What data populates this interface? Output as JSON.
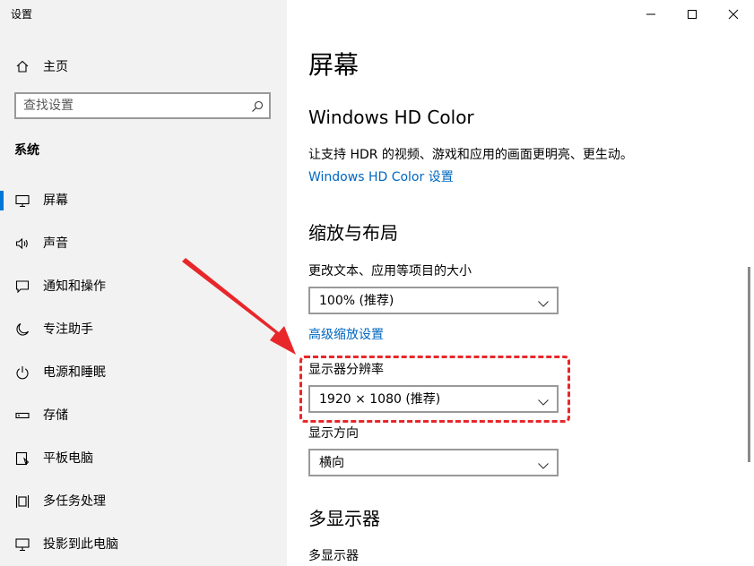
{
  "app": {
    "title": "设置"
  },
  "sidebar": {
    "home_label": "主页",
    "search": {
      "placeholder": "查找设置",
      "value": ""
    },
    "section_title": "系统",
    "items": [
      {
        "label": "屏幕",
        "icon": "monitor-icon",
        "selected": true
      },
      {
        "label": "声音",
        "icon": "speaker-icon"
      },
      {
        "label": "通知和操作",
        "icon": "notification-icon"
      },
      {
        "label": "专注助手",
        "icon": "moon-icon"
      },
      {
        "label": "电源和睡眠",
        "icon": "power-icon"
      },
      {
        "label": "存储",
        "icon": "storage-icon"
      },
      {
        "label": "平板电脑",
        "icon": "tablet-icon"
      },
      {
        "label": "多任务处理",
        "icon": "multitask-icon"
      },
      {
        "label": "投影到此电脑",
        "icon": "project-icon"
      }
    ]
  },
  "main": {
    "page_title": "屏幕",
    "hdr": {
      "title": "Windows HD Color",
      "description": "让支持 HDR 的视频、游戏和应用的画面更明亮、更生动。",
      "link": "Windows HD Color 设置"
    },
    "scale": {
      "title": "缩放与布局",
      "size_label": "更改文本、应用等项目的大小",
      "size_value": "100% (推荐)",
      "advanced_link": "高级缩放设置",
      "resolution_label": "显示器分辨率",
      "resolution_value": "1920 × 1080 (推荐)",
      "orientation_label": "显示方向",
      "orientation_value": "横向"
    },
    "multi": {
      "title": "多显示器",
      "label": "多显示器"
    }
  },
  "colors": {
    "accent": "#0078d7",
    "link": "#0067c0",
    "sidebar_bg": "#f2f2f2",
    "annotation": "#e8272b"
  }
}
